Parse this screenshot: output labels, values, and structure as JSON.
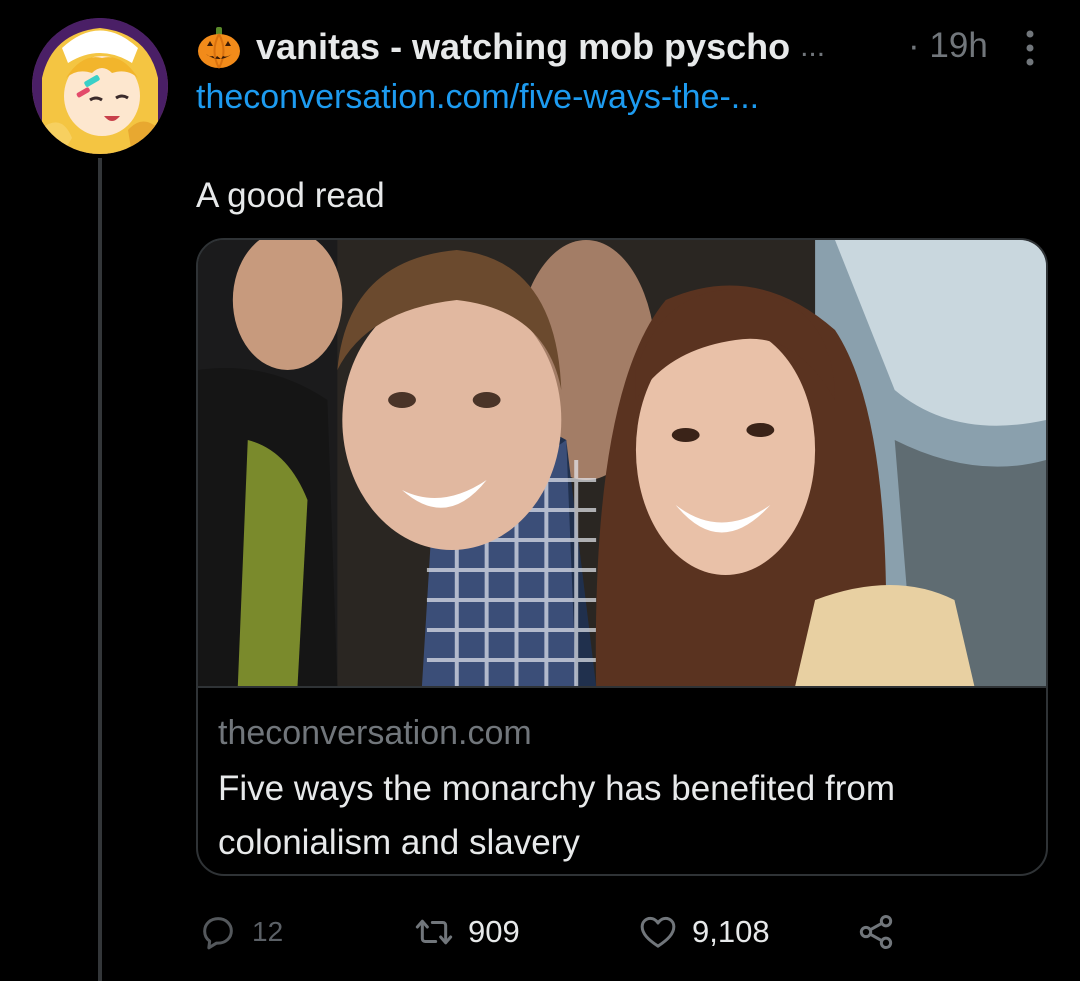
{
  "tweet": {
    "display_name": "vanitas - watching mob pyscho",
    "name_truncation": "...",
    "time_separator": "·",
    "time": "19h",
    "link": "theconversation.com/five-ways-the-...",
    "text": "A good read",
    "avatar_icon": "anime-avatar-icon",
    "name_emoji_icon": "pumpkin-icon"
  },
  "card": {
    "domain": "theconversation.com",
    "title": "Five ways the monarchy has benefited from colonialism and slavery"
  },
  "actions": {
    "replies": "12",
    "retweets": "909",
    "likes": "9,108"
  },
  "colors": {
    "background": "#000000",
    "text_primary": "#e7e9ea",
    "text_secondary": "#71767b",
    "link": "#1d9bf0",
    "border": "#2f3336"
  }
}
